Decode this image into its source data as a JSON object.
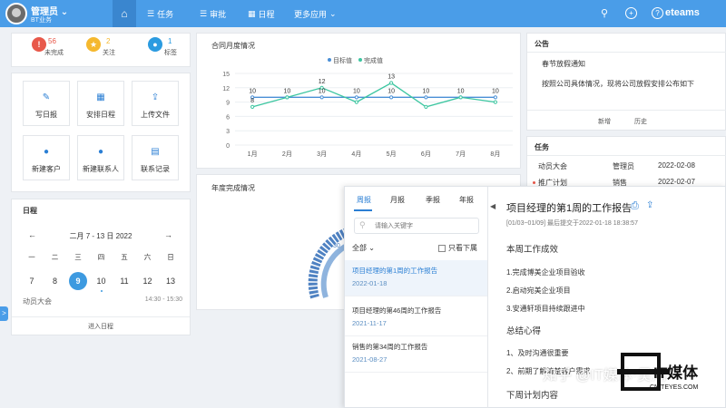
{
  "header": {
    "user_name": "管理员",
    "user_caret": "⌄",
    "department": "BT业务",
    "nav": [
      {
        "label": "任务",
        "icon": "☰"
      },
      {
        "label": "审批",
        "icon": "☰"
      },
      {
        "label": "日程",
        "icon": "▦"
      },
      {
        "label": "更多应用",
        "icon": "⌄"
      }
    ],
    "icons": {
      "search": "⚲",
      "add": "+",
      "help": "?",
      "home": "⌂"
    },
    "brand": "eteams"
  },
  "stats": [
    {
      "value": "56",
      "label": "未完成",
      "color": "#e8584a",
      "icon": "!"
    },
    {
      "value": "2",
      "label": "关注",
      "color": "#f5b82e",
      "icon": "★"
    },
    {
      "value": "1",
      "label": "标签",
      "color": "#2b9be0",
      "icon": "●"
    }
  ],
  "quick_actions": [
    {
      "label": "写日报",
      "icon": "✎"
    },
    {
      "label": "安排日程",
      "icon": "▦"
    },
    {
      "label": "上传文件",
      "icon": "⇪"
    },
    {
      "label": "新建客户",
      "icon": "●"
    },
    {
      "label": "新建联系人",
      "icon": "●"
    },
    {
      "label": "联系记录",
      "icon": "▤"
    }
  ],
  "calendar": {
    "title": "日程",
    "range": "二月 7 - 13 日 2022",
    "prev": "←",
    "next": "→",
    "weekdays": [
      "一",
      "二",
      "三",
      "四",
      "五",
      "六",
      "日"
    ],
    "days": [
      "7",
      "8",
      "9",
      "10",
      "11",
      "12",
      "13"
    ],
    "selected_index": 2,
    "event_dot_indices": [
      3
    ],
    "event": {
      "name": "动员大会",
      "time": "14:30 - 15:30"
    },
    "footer": "进入日程"
  },
  "contract_chart": {
    "title": "合同月度情况",
    "legend": [
      {
        "label": "目标值",
        "color": "#4a8fd6"
      },
      {
        "label": "完成值",
        "color": "#3cc6a0"
      }
    ]
  },
  "annual": {
    "title": "年度完成情况",
    "gauge_value": "30"
  },
  "chart_data": {
    "type": "line",
    "title": "合同月度情况",
    "categories": [
      "1月",
      "2月",
      "3月",
      "4月",
      "5月",
      "6月",
      "7月",
      "8月"
    ],
    "series": [
      {
        "name": "目标值",
        "values": [
          10,
          10,
          10,
          10,
          10,
          10,
          10,
          10
        ]
      },
      {
        "name": "完成值",
        "values": [
          8,
          10,
          12,
          9,
          13,
          8,
          10,
          9
        ]
      }
    ],
    "ylim": [
      0,
      15
    ],
    "yticks": [
      0,
      3,
      6,
      9,
      12,
      15
    ],
    "data_labels_target": [
      "10",
      "10",
      "10",
      "10",
      "10",
      "10",
      "10",
      "10"
    ],
    "data_labels_done": [
      "8",
      "",
      "12",
      "",
      "13",
      "",
      "",
      ""
    ],
    "grid": true,
    "legend_position": "top-right"
  },
  "notice": {
    "title": "公告",
    "item_title": "春节放假通知",
    "item_body": "按照公司具体情况，现将公司放假安排公布如下",
    "actions": [
      "新增",
      "历史"
    ]
  },
  "tasks": {
    "title": "任务",
    "rows": [
      {
        "name": "动员大会",
        "owner": "管理员",
        "date": "2022-02-08"
      },
      {
        "name": "推广计划",
        "owner": "销售",
        "date": "2022-02-07"
      }
    ]
  },
  "reports_popup": {
    "tabs": [
      "周报",
      "月报",
      "季报",
      "年报"
    ],
    "active_tab": 0,
    "search_placeholder": "请输入关键字",
    "search_icon": "⚲",
    "filter_all": "全部",
    "filter_caret": "⌄",
    "only_subordinates": "只看下属",
    "collapse_arrow": "◀",
    "items": [
      {
        "title": "项目经理的第1周的工作报告",
        "date": "2022-01-18"
      },
      {
        "title": "项目经理的第46周的工作报告",
        "date": "2021-11-17"
      },
      {
        "title": "销售的第34周的工作报告",
        "date": "2021-08-27"
      }
    ],
    "detail": {
      "title": "项目经理的第1周的工作报告",
      "print_icon": "⎙",
      "share_icon": "⇪",
      "meta": "[01/03~01/09]  最后提交于2022-01-18 18:38:57",
      "section1": "本周工作成效",
      "lines": [
        "1.完成博美企业项目验收",
        "2.启动宛美企业项目",
        "3.安通轩项目持续跟进中"
      ],
      "section2": "总结心得",
      "lines2": [
        "1、及时沟通很重要",
        "2、前期了解清楚客户需求"
      ],
      "section3": "下周计划内容"
    }
  },
  "watermark": {
    "text": "知乎 @IT媒体·吴鸿",
    "brand_big": "IT媒体",
    "brand_small": "CNITEYES.COM"
  },
  "side_handle": ">"
}
